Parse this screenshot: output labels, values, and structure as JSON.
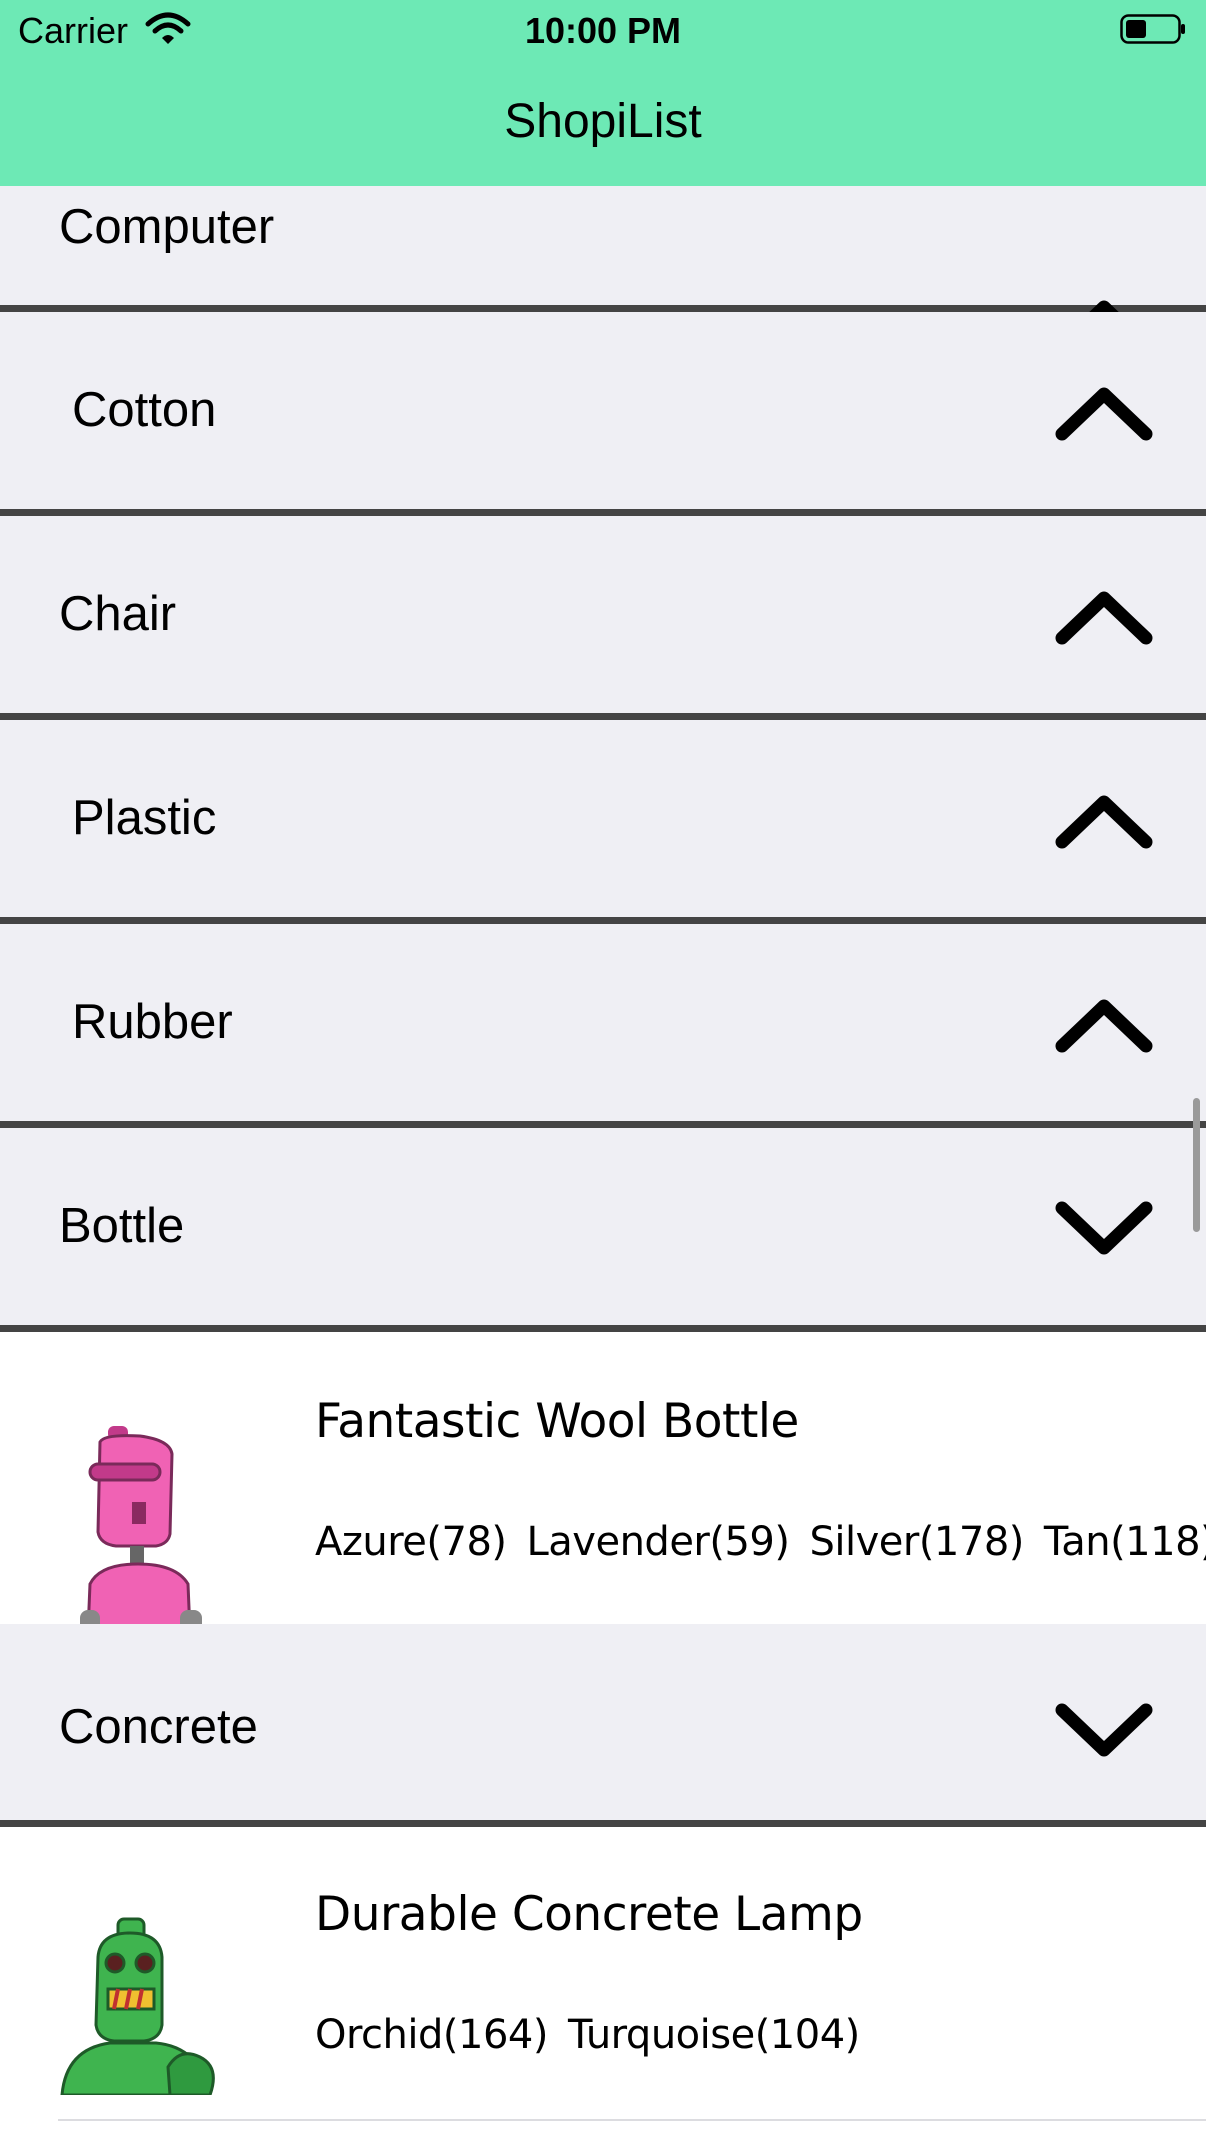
{
  "status": {
    "carrier": "Carrier",
    "time": "10:00 PM"
  },
  "nav": {
    "title": "ShopiList"
  },
  "sections": [
    {
      "label": "Computer",
      "expanded": false
    },
    {
      "label": " Cotton",
      "expanded": false
    },
    {
      "label": "Chair",
      "expanded": false
    },
    {
      "label": " Plastic",
      "expanded": false
    },
    {
      "label": " Rubber",
      "expanded": false
    },
    {
      "label": "Bottle",
      "expanded": true
    },
    {
      "label": "Concrete",
      "expanded": true
    }
  ],
  "products": [
    {
      "name": "Fantastic Wool Bottle",
      "variants": [
        "Azure(78)",
        "Lavender(59)",
        "Silver(178)",
        "Tan(118)"
      ],
      "robot_color": "#f062b4"
    },
    {
      "name": "Durable Concrete Lamp",
      "variants": [
        "Orchid(164)",
        "Turquoise(104)"
      ],
      "robot_color": "#3fb44f"
    }
  ],
  "icons": {
    "collapse": "chevron-up-icon",
    "expand": "chevron-down-icon",
    "wifi": "wifi-icon",
    "battery": "battery-icon"
  },
  "colors": {
    "nav_bg": "#6de9b5",
    "section_bg": "#efeff4",
    "separator": "#444444"
  }
}
